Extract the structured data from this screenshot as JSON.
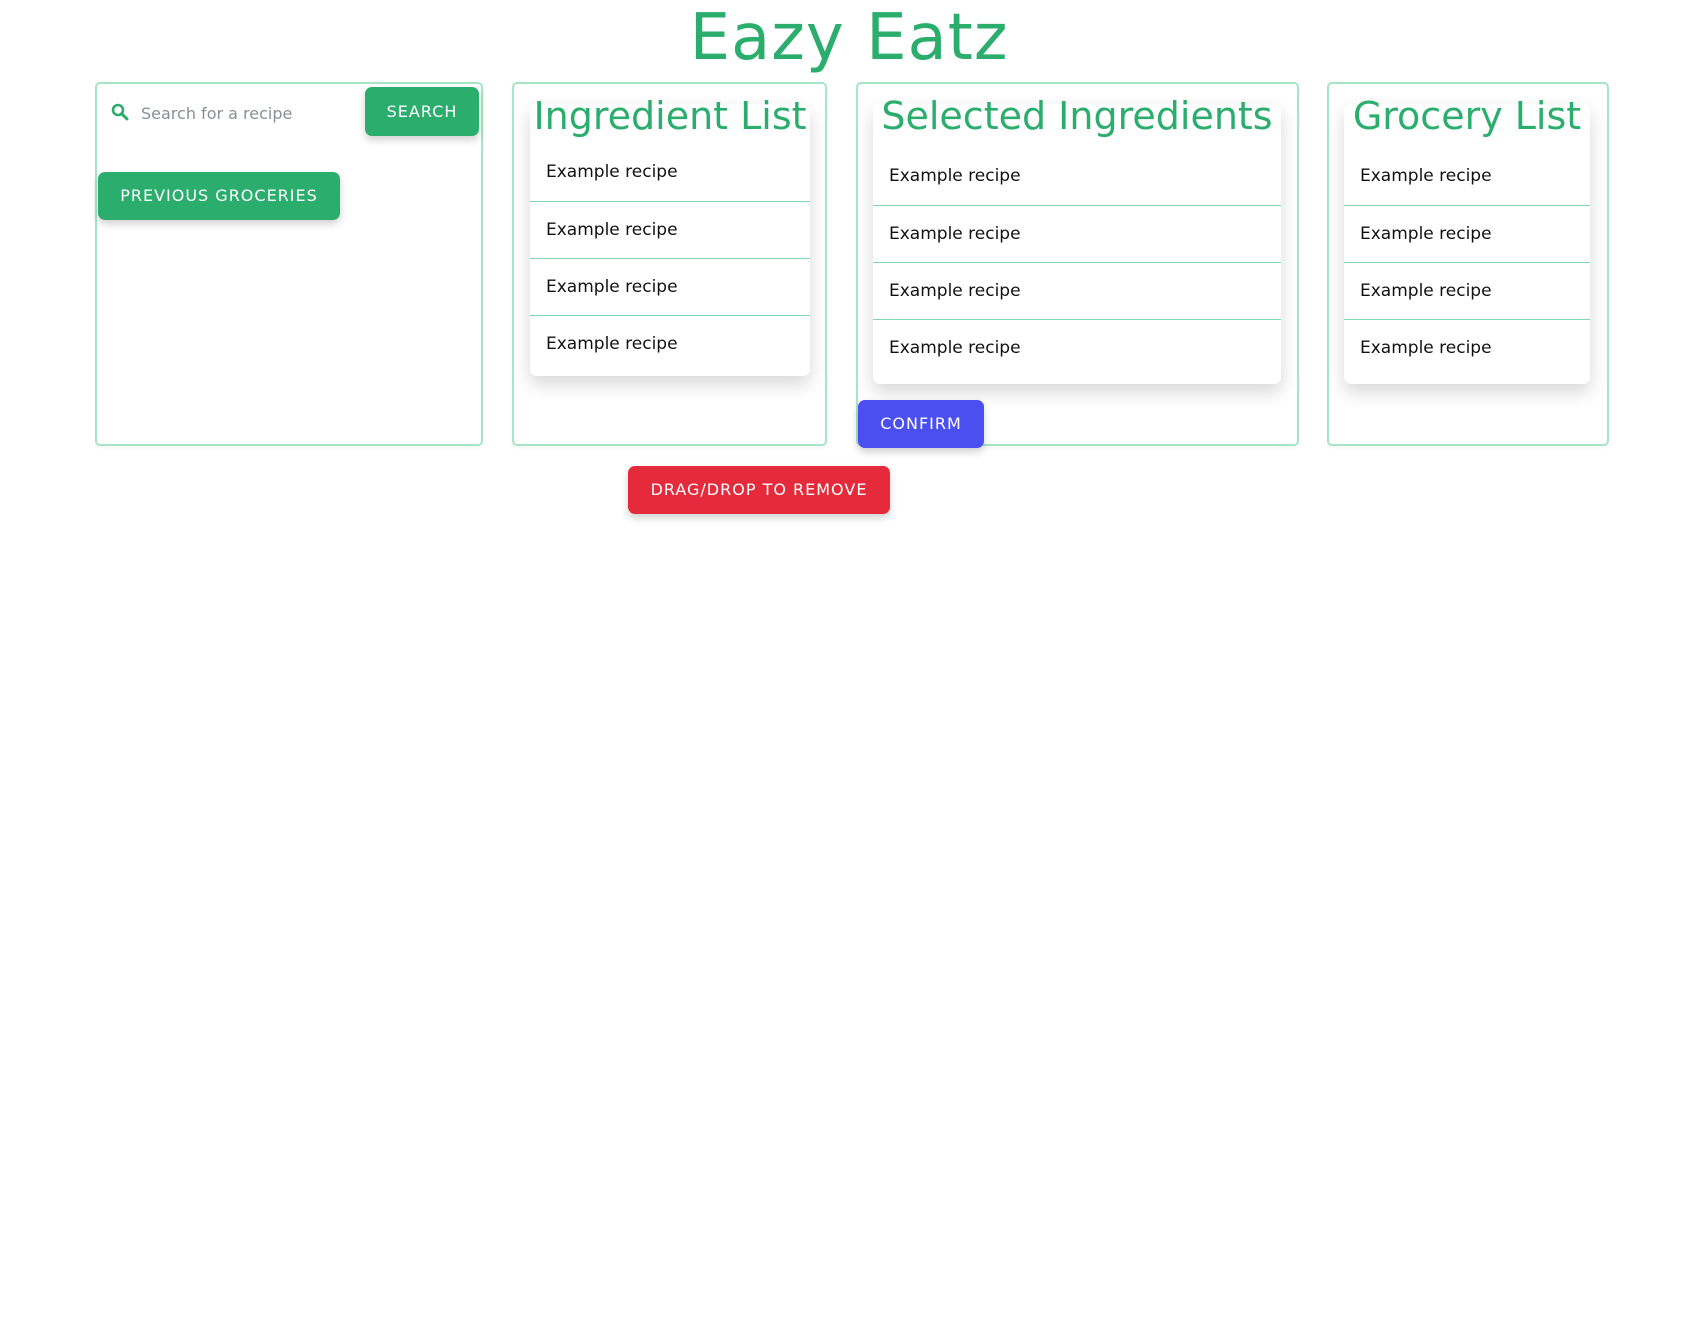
{
  "app": {
    "title": "Eazy Eatz",
    "colors": {
      "brand_green": "#2bae6d",
      "panel_border": "#a6e6c6",
      "confirm_blue": "#4b4ff0",
      "remove_red": "#e52b3b"
    }
  },
  "search": {
    "icon": "search-icon",
    "placeholder": "Search for a recipe",
    "value": "",
    "button_label": "SEARCH",
    "previous_groceries_label": "PREVIOUS GROCERIES"
  },
  "ingredient_list": {
    "title": "Ingredient List",
    "items": [
      "Example recipe",
      "Example recipe",
      "Example recipe",
      "Example recipe"
    ]
  },
  "selected_ingredients": {
    "title": "Selected Ingredients",
    "items": [
      "Example recipe",
      "Example recipe",
      "Example recipe",
      "Example recipe"
    ],
    "confirm_label": "CONFIRM"
  },
  "grocery_list": {
    "title": "Grocery List",
    "items": [
      "Example recipe",
      "Example recipe",
      "Example recipe",
      "Example recipe"
    ]
  },
  "remove_zone": {
    "label": "DRAG/DROP TO REMOVE"
  }
}
